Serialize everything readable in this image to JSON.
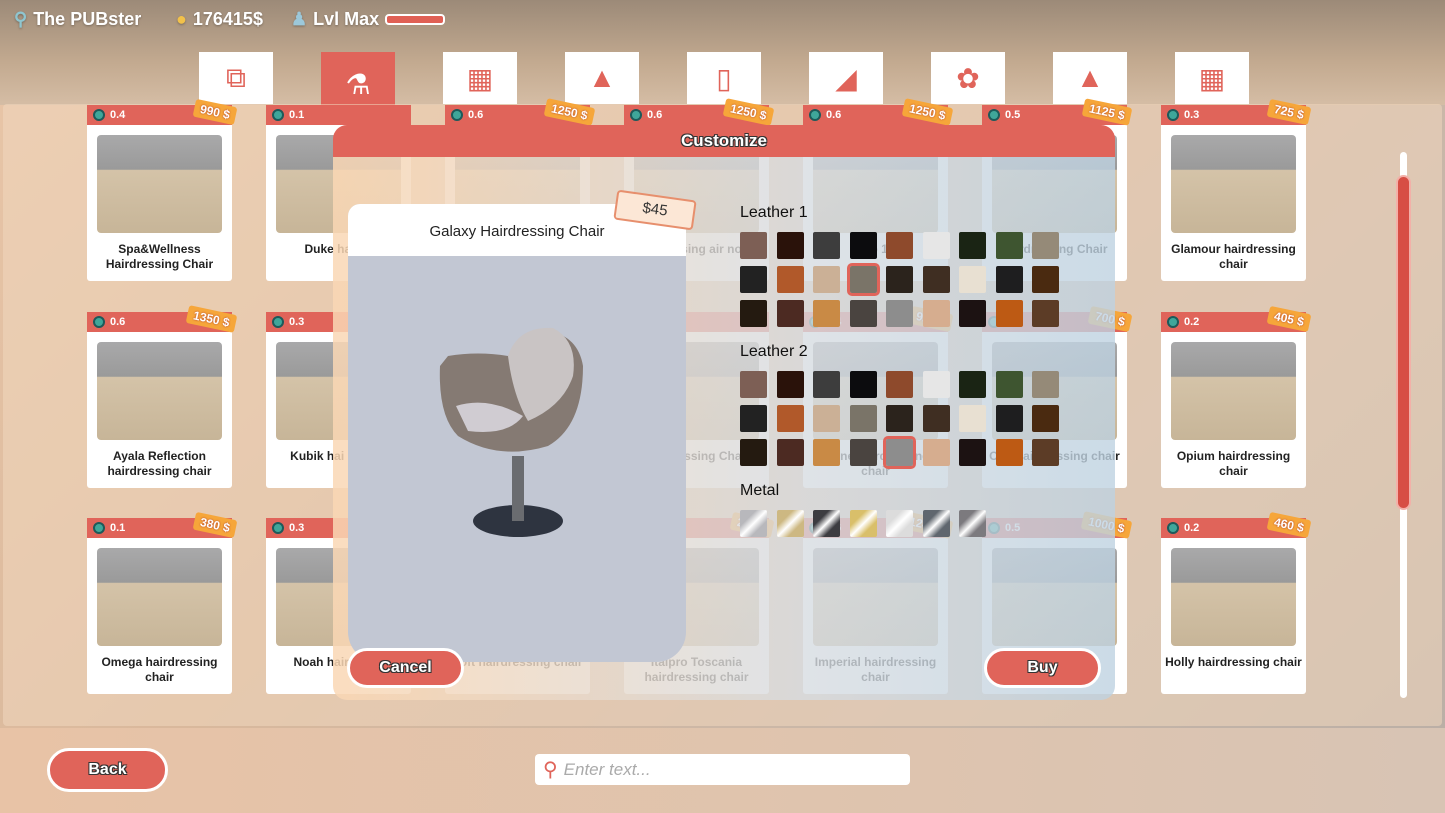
{
  "header": {
    "location": "The PUBster",
    "money": "176415$",
    "level": "Lvl Max",
    "level_progress": 1.0
  },
  "categories": [
    {
      "icon": "layers-icon",
      "active": false
    },
    {
      "icon": "barber-chair-icon",
      "active": true
    },
    {
      "icon": "armchair-icon",
      "active": false
    },
    {
      "icon": "bottles-icon",
      "active": false
    },
    {
      "icon": "mirror-station-icon",
      "active": false
    },
    {
      "icon": "wash-chair-icon",
      "active": false
    },
    {
      "icon": "plant-icon",
      "active": false
    },
    {
      "icon": "lamp-icon",
      "active": false
    },
    {
      "icon": "chair-icon",
      "active": false
    }
  ],
  "cards": [
    {
      "gem": "0.4",
      "price": "990 $",
      "name": "Spa&Wellness Hairdressing Chair"
    },
    {
      "gem": "0.1",
      "price": "",
      "name": "Duke hai ho"
    },
    {
      "gem": "0.6",
      "price": "1250 $",
      "name": ""
    },
    {
      "gem": "0.6",
      "price": "1250 $",
      "name": "airdressing air no 2"
    },
    {
      "gem": "0.6",
      "price": "1250 $",
      "name": "no 1"
    },
    {
      "gem": "0.5",
      "price": "1125 $",
      "name": "hairdressing Chair"
    },
    {
      "gem": "0.3",
      "price": "725 $",
      "name": "Glamour hairdressing chair"
    },
    {
      "gem": "0.6",
      "price": "1350 $",
      "name": "Ayala Reflection hairdressing chair"
    },
    {
      "gem": "0.3",
      "price": "",
      "name": "Kubik hai chair n"
    },
    {
      "gem": "",
      "price": "",
      "name": ""
    },
    {
      "gem": "",
      "price": "",
      "name": "hairdressing Chair"
    },
    {
      "gem": "0.4",
      "price": "920 $",
      "name": "Shine hairdressing chair"
    },
    {
      "gem": "0.3",
      "price": "700 $",
      "name": "Ovo hairdressing chair"
    },
    {
      "gem": "0.2",
      "price": "405 $",
      "name": "Opium hairdressing chair"
    },
    {
      "gem": "0.1",
      "price": "380 $",
      "name": "Omega hairdressing chair"
    },
    {
      "gem": "0.3",
      "price": "",
      "name": "Noah haird chai"
    },
    {
      "gem": "",
      "price": "",
      "name": "Loft hairdressing chair"
    },
    {
      "gem": "",
      "price": "200 $",
      "name": "Italpro Toscania hairdressing chair"
    },
    {
      "gem": "0.6",
      "price": "1240 $",
      "name": "Imperial hairdressing chair"
    },
    {
      "gem": "0.5",
      "price": "1000 $",
      "name": "1"
    },
    {
      "gem": "0.2",
      "price": "460 $",
      "name": "Holly hairdressing chair"
    }
  ],
  "modal": {
    "title": "Customize",
    "product_name": "Galaxy Hairdressing Chair",
    "price": "$45",
    "groups": [
      {
        "label": "Leather 1",
        "selected": 12,
        "colors": [
          "#7d5f55",
          "#2a120a",
          "#3d3d3d",
          "#0c0c0e",
          "#8e4a2c",
          "#e6e6e6",
          "#1a2414",
          "#3e5530",
          "#958a78",
          "#222222",
          "#b1592a",
          "#cbb096",
          "#7a7468",
          "#2b231c",
          "#3f2e22",
          "#e8e0d2",
          "#1e1e1f",
          "#4a2a10",
          "#241a10",
          "#4c2a22",
          "#c98a45",
          "#4a4440",
          "#8d8d8d",
          "#d6ad8f",
          "#1c1212",
          "#bd5a14",
          "#5c3c26"
        ]
      },
      {
        "label": "Leather 2",
        "selected": 22,
        "colors": [
          "#7d5f55",
          "#2a120a",
          "#3d3d3d",
          "#0c0c0e",
          "#8e4a2c",
          "#e6e6e6",
          "#1a2414",
          "#3e5530",
          "#958a78",
          "#222222",
          "#b1592a",
          "#cbb096",
          "#7a7468",
          "#2b231c",
          "#3f2e22",
          "#e8e0d2",
          "#1e1e1f",
          "#4a2a10",
          "#241a10",
          "#4c2a22",
          "#c98a45",
          "#4a4440",
          "#8d8d8d",
          "#d6ad8f",
          "#1c1212",
          "#bd5a14",
          "#5c3c26"
        ]
      },
      {
        "label": "Metal",
        "selected": -1,
        "colors": [
          "#b8b8bc",
          "#cdb882",
          "#3c3c40",
          "#d9bf6a",
          "#dcdcdc",
          "#5f666e",
          "#7c7a7e"
        ]
      }
    ],
    "cancel_label": "Cancel",
    "buy_label": "Buy"
  },
  "footer": {
    "back_label": "Back",
    "search_placeholder": "Enter text..."
  },
  "colors": {
    "accent": "#e0645a",
    "gem": "#3fa69a",
    "price_tag": "#f6a63a"
  }
}
